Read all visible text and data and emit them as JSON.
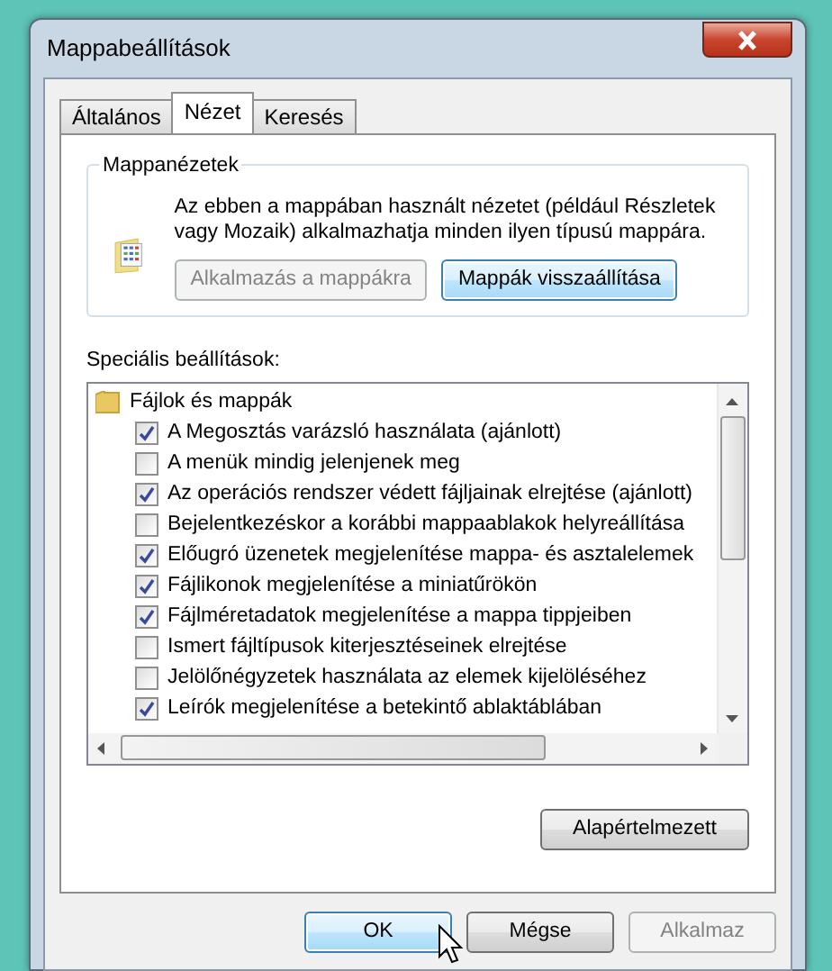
{
  "window": {
    "title": "Mappabeállítások"
  },
  "tabs": [
    {
      "label": "Általános",
      "selected": false
    },
    {
      "label": "Nézet",
      "selected": true
    },
    {
      "label": "Keresés",
      "selected": false
    }
  ],
  "folder_views": {
    "title": "Mappanézetek",
    "description": "Az ebben a mappában használt nézetet (például Részletek vagy Mozaik) alkalmazhatja minden ilyen típusú mappára.",
    "buttons": [
      {
        "label": "Alkalmazás a mappákra",
        "disabled": true,
        "highlighted": false
      },
      {
        "label": "Mappák visszaállítása",
        "disabled": false,
        "highlighted": true
      }
    ]
  },
  "advanced": {
    "label": "Speciális beállítások:",
    "tree": [
      {
        "kind": "folder",
        "label": "Fájlok és mappák",
        "children": [
          {
            "kind": "checkbox",
            "label": "A Megosztás varázsló használata (ajánlott)",
            "checked": true
          },
          {
            "kind": "checkbox",
            "label": "A menük mindig jelenjenek meg",
            "checked": false
          },
          {
            "kind": "checkbox",
            "label": "Az operációs rendszer védett fájljainak elrejtése (ajánlott)",
            "checked": true
          },
          {
            "kind": "checkbox",
            "label": "Bejelentkezéskor a korábbi mappaablakok helyreállítása",
            "checked": false
          },
          {
            "kind": "checkbox",
            "label": "Előugró üzenetek megjelenítése mappa- és asztalelemek",
            "checked": true
          },
          {
            "kind": "checkbox",
            "label": "Fájlikonok megjelenítése a miniatűrökön",
            "checked": true
          },
          {
            "kind": "checkbox",
            "label": "Fájlméretadatok megjelenítése a mappa tippjeiben",
            "checked": true
          },
          {
            "kind": "checkbox",
            "label": "Ismert fájltípusok kiterjesztéseinek elrejtése",
            "checked": false
          },
          {
            "kind": "checkbox",
            "label": "Jelölőnégyzetek használata az elemek kijelöléséhez",
            "checked": false
          },
          {
            "kind": "checkbox",
            "label": "Leírók megjelenítése a betekintő ablaktáblában",
            "checked": true
          }
        ]
      }
    ],
    "defaults_button": {
      "label": "Alapértelmezett",
      "disabled": false,
      "highlighted": false
    }
  },
  "buttons": [
    {
      "label": "OK",
      "disabled": false,
      "highlighted": true
    },
    {
      "label": "Mégse",
      "disabled": false,
      "highlighted": false
    },
    {
      "label": "Alkalmaz",
      "disabled": true,
      "highlighted": false
    }
  ]
}
